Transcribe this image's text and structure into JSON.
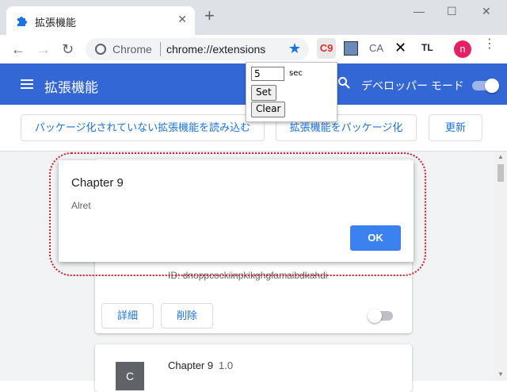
{
  "window": {
    "tab_title": "拡張機能",
    "tab_close": "✕",
    "new_tab": "+",
    "minimize": "—",
    "maximize": "☐",
    "close": "✕"
  },
  "toolbar": {
    "back": "←",
    "forward": "→",
    "reload": "↻",
    "omnibox_label": "Chrome",
    "url": "chrome://extensions",
    "star": "★",
    "ext_c9": "C9",
    "ext_ca": "CA",
    "ext_x": "✕",
    "ext_tl": "TL",
    "avatar_letter": "n",
    "menu": "⋮"
  },
  "header": {
    "title": "拡張機能",
    "search_icon": "🔍",
    "dev_mode_label": "デベロッパー モード",
    "dev_mode_on": true
  },
  "subbar": {
    "load_unpacked": "パッケージ化されていない拡張機能を読み込む",
    "pack_extension": "拡張機能をパッケージ化",
    "update": "更新"
  },
  "card1": {
    "id_line": "ID: dnoppcockiinpkikghgfamaibdkahdi",
    "details": "詳細",
    "remove": "削除"
  },
  "card2": {
    "icon_letter": "C",
    "name": "Chapter 9",
    "version": "1.0"
  },
  "dialog": {
    "title": "Chapter 9",
    "message": "Alret",
    "ok": "OK"
  },
  "popup": {
    "sec_value": "5",
    "sec_label": "sec",
    "set": "Set",
    "clear": "Clear"
  },
  "colors": {
    "appbar": "#3367d6",
    "accent": "#1a73e8",
    "highlight": "#e01b24"
  }
}
